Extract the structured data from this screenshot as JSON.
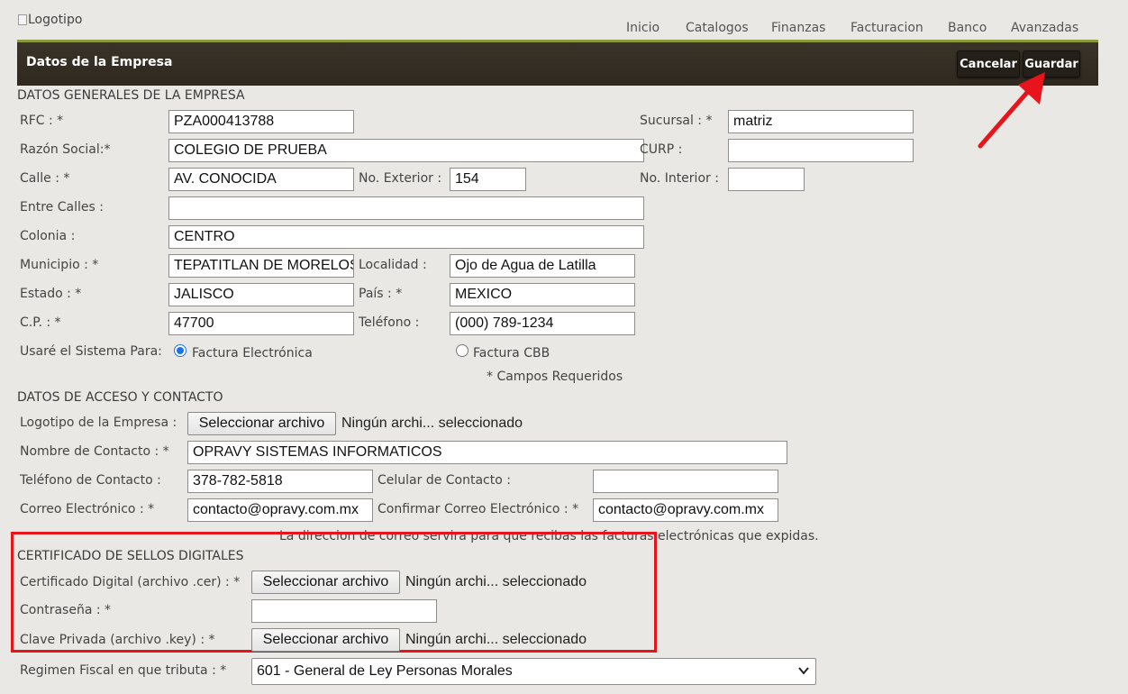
{
  "header": {
    "logo_alt": "Logotipo",
    "nav": [
      "Inicio",
      "Catalogos",
      "Finanzas",
      "Facturacion",
      "Banco",
      "Avanzadas"
    ],
    "title": "Datos de la Empresa",
    "cancel_label": "Cancelar",
    "save_label": "Guardar"
  },
  "general": {
    "section_title": "DATOS GENERALES DE LA EMPRESA",
    "rfc_label": "RFC : *",
    "rfc_value": "PZA000413788",
    "sucursal_label": "Sucursal : *",
    "sucursal_value": "matriz",
    "razon_label": "Razón Social:*",
    "razon_value": "COLEGIO DE PRUEBA",
    "curp_label": "CURP :",
    "curp_value": "",
    "calle_label": "Calle : *",
    "calle_value": "AV. CONOCIDA",
    "no_ext_label": "No. Exterior :",
    "no_ext_value": "154",
    "no_int_label": "No. Interior :",
    "no_int_value": "",
    "entre_label": "Entre Calles :",
    "entre_value": "",
    "colonia_label": "Colonia :",
    "colonia_value": "CENTRO",
    "municipio_label": "Municipio : *",
    "municipio_value": "TEPATITLAN DE MORELOS",
    "localidad_label": "Localidad :",
    "localidad_value": "Ojo de Agua de Latilla",
    "estado_label": "Estado : *",
    "estado_value": "JALISCO",
    "pais_label": "País : *",
    "pais_value": "MEXICO",
    "cp_label": "C.P. : *",
    "cp_value": "47700",
    "telefono_label": "Teléfono :",
    "telefono_value": "(000) 789-1234",
    "usare_label": "Usaré el Sistema Para:",
    "opt_electronica": "Factura Electrónica",
    "opt_cbb": "Factura CBB",
    "required_note": "* Campos Requeridos"
  },
  "contact": {
    "section_title": "DATOS DE ACCESO Y CONTACTO",
    "logotipo_label": "Logotipo de la Empresa :",
    "file_button": "Seleccionar archivo",
    "file_none": "Ningún archi... seleccionado",
    "nombre_label": "Nombre de Contacto : *",
    "nombre_value": "OPRAVY SISTEMAS INFORMATICOS",
    "tel_label": "Teléfono de Contacto :",
    "tel_value": "378-782-5818",
    "celular_label": "Celular de Contacto :",
    "celular_value": "",
    "correo_label": "Correo Electrónico : *",
    "correo_value": "contacto@opravy.com.mx",
    "confirmar_label": "Confirmar Correo Electrónico : *",
    "confirmar_value": "contacto@opravy.com.mx",
    "correo_note": "La direccion de correo servira para que recibas las facturas electrónicas que expidas."
  },
  "certificate": {
    "section_title": "CERTIFICADO DE SELLOS DIGITALES",
    "cer_label": "Certificado Digital (archivo .cer) : *",
    "password_label": "Contraseña : *",
    "password_value": "",
    "key_label": "Clave Privada (archivo .key) : *",
    "file_button": "Seleccionar archivo",
    "file_none": "Ningún archi... seleccionado"
  },
  "fiscal": {
    "regimen_label": "Regimen Fiscal en que tributa : *",
    "regimen_value": "601 - General de Ley Personas Morales"
  },
  "colors": {
    "accent_bar": "#8a9a3a",
    "title_bar": "#2e281f",
    "highlight": "#e8141b",
    "radio": "#1a73e8"
  }
}
